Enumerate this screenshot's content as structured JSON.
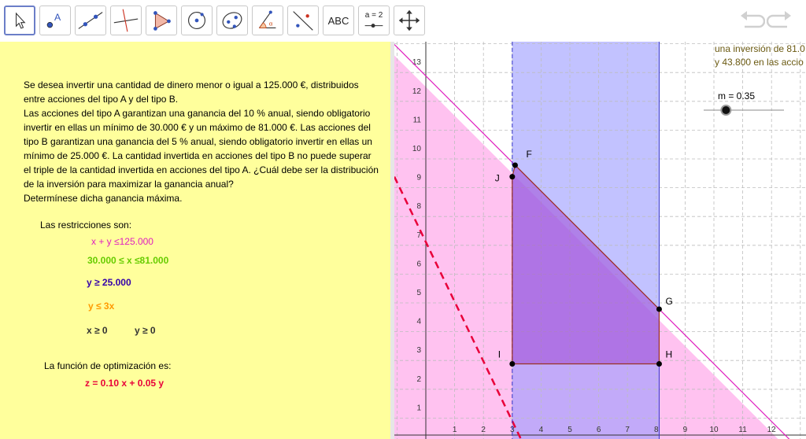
{
  "toolbar": {
    "tools": [
      {
        "name": "move-tool",
        "icon": "arrow-cursor-icon"
      },
      {
        "name": "point-tool",
        "icon": "point-icon"
      },
      {
        "name": "line-tool",
        "icon": "line-icon"
      },
      {
        "name": "perpendicular-tool",
        "icon": "perpendicular-line-icon"
      },
      {
        "name": "polygon-tool",
        "icon": "polygon-icon"
      },
      {
        "name": "circle-tool",
        "icon": "circle-center-icon"
      },
      {
        "name": "conic-tool",
        "icon": "ellipse-icon"
      },
      {
        "name": "angle-tool",
        "icon": "angle-icon"
      },
      {
        "name": "reflect-tool",
        "icon": "reflect-icon"
      },
      {
        "name": "text-tool",
        "label": "ABC"
      },
      {
        "name": "slider-tool",
        "label": "a = 2"
      },
      {
        "name": "move-graphics-tool",
        "icon": "move-arrows-icon"
      }
    ],
    "undo_icon": "undo-icon",
    "redo_icon": "redo-icon"
  },
  "problem": {
    "lines": [
      "Se desea invertir una cantidad de dinero menor o igual a 125.000 €, distribuidos",
      "entre acciones del tipo A y del tipo B.",
      "Las acciones del tipo A garantizan una ganancia del 10 % anual, siendo obligatorio",
      "invertir en ellas un mínimo de 30.000 € y un máximo de 81.000 €. Las acciones del",
      "tipo B garantizan una ganancia del 5 % anual, siendo obligatorio invertir en ellas un",
      "mínimo de 25.000 €. La cantidad invertida en acciones del tipo B no puede superar",
      "el triple de la cantidad invertida en acciones del tipo A. ¿Cuál debe ser la distribución",
      "de la inversión para maximizar la ganancia anual?",
      "Determínese dicha ganancia máxima."
    ]
  },
  "restrictions": {
    "title": "Las restricciones son:",
    "r1": "x + y ≤125.000",
    "r2": "30.000 ≤ x  ≤81.000",
    "r3": "y ≥ 25.000",
    "r4": "y ≤ 3x",
    "r5a": "x ≥ 0",
    "r5b": "y ≥ 0"
  },
  "optimization": {
    "title": "La función de optimización es:",
    "formula": "z = 0.10 x + 0.05 y"
  },
  "colors": {
    "panel_bg": "#ffff9c",
    "r1": "#e020c0",
    "r2": "#66cc00",
    "r3": "#3300aa",
    "r4": "#ff9900",
    "r5": "#333333",
    "formula": "#e8003a",
    "restriction_title": "#000000",
    "pink_region": "#ff99e6",
    "blue_region": "#9999ff",
    "feasible": "#9933cc",
    "dashed_line": "#e8003a",
    "top_text": "#6b5a12"
  },
  "graphics": {
    "top_text_1": "una inversión de 81.0",
    "top_text_2": "y 43.800 en las accio",
    "slider_label": "m = 0.35",
    "slider_value": 0.35,
    "x_ticks": [
      "1",
      "2",
      "3",
      "4",
      "5",
      "6",
      "7",
      "8",
      "9",
      "10",
      "11",
      "12"
    ],
    "y_ticks": [
      "1",
      "2",
      "3",
      "4",
      "5",
      "6",
      "7",
      "8",
      "9",
      "10",
      "11",
      "12",
      "13"
    ],
    "points": [
      {
        "label": "F",
        "x": 3.1,
        "y": 9.4
      },
      {
        "label": "J",
        "x": 3.0,
        "y": 9.0
      },
      {
        "label": "G",
        "x": 8.1,
        "y": 4.4
      },
      {
        "label": "H",
        "x": 8.1,
        "y": 2.5
      },
      {
        "label": "I",
        "x": 3.0,
        "y": 2.5
      }
    ]
  }
}
